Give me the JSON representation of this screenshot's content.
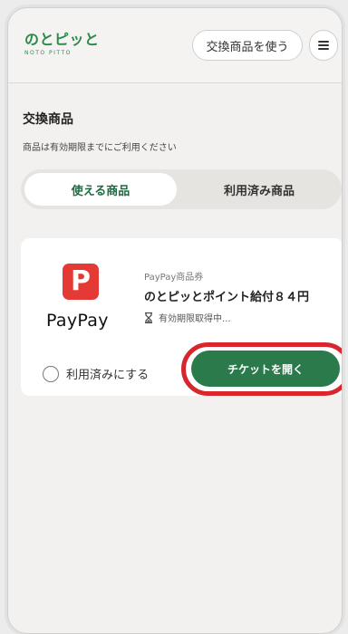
{
  "header": {
    "logo_text": "のとピッと",
    "logo_sub": "NOTO PITTO",
    "exchange_button": "交換商品を使う"
  },
  "main": {
    "title": "交換商品",
    "description": "商品は有効期限までにご利用ください",
    "tabs": [
      {
        "label": "使える商品",
        "active": true
      },
      {
        "label": "利用済み商品",
        "active": false
      }
    ],
    "product": {
      "brand_letter": "P",
      "brand_name": "PayPay",
      "category": "PayPay商品券",
      "name": "のとピッとポイント給付８４円",
      "expiry_status": "有効期限取得中...",
      "mark_used_label": "利用済みにする",
      "open_ticket_label": "チケットを開く"
    }
  },
  "colors": {
    "brand_green": "#2b7a4b",
    "paypay_red": "#e53935",
    "highlight_red": "#d9262c"
  }
}
